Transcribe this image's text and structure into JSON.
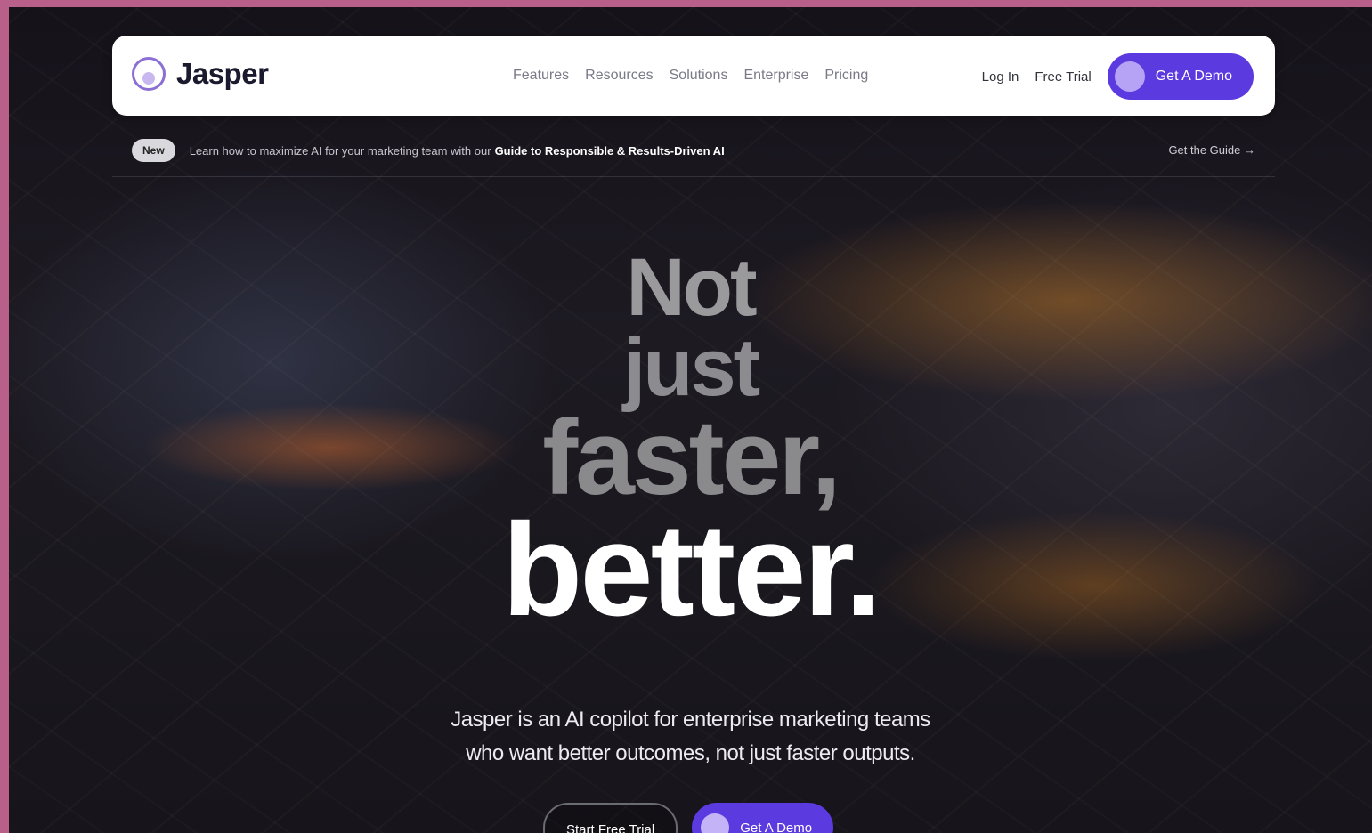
{
  "navbar": {
    "logo_text": "Jasper",
    "links": [
      "Features",
      "Resources",
      "Solutions",
      "Enterprise",
      "Pricing"
    ],
    "login_label": "Log In",
    "free_trial_label": "Free Trial",
    "demo_label": "Get A Demo"
  },
  "announcement": {
    "badge": "New",
    "text": "Learn how to maximize AI for your marketing team with our",
    "bold_text": "Guide to Responsible & Results-Driven AI",
    "cta": "Get the Guide →"
  },
  "hero": {
    "line1": "Not",
    "line2": "just",
    "line3": "faster,",
    "line4": "better.",
    "subtitle_line1": "Jasper is an AI copilot for enterprise marketing teams",
    "subtitle_line2": "who want better outcomes, not just faster outputs.",
    "cta_secondary": "Start Free Trial",
    "cta_primary": "Get A Demo"
  },
  "colors": {
    "brand_purple": "#5b3ae0",
    "background": "#17151b"
  }
}
